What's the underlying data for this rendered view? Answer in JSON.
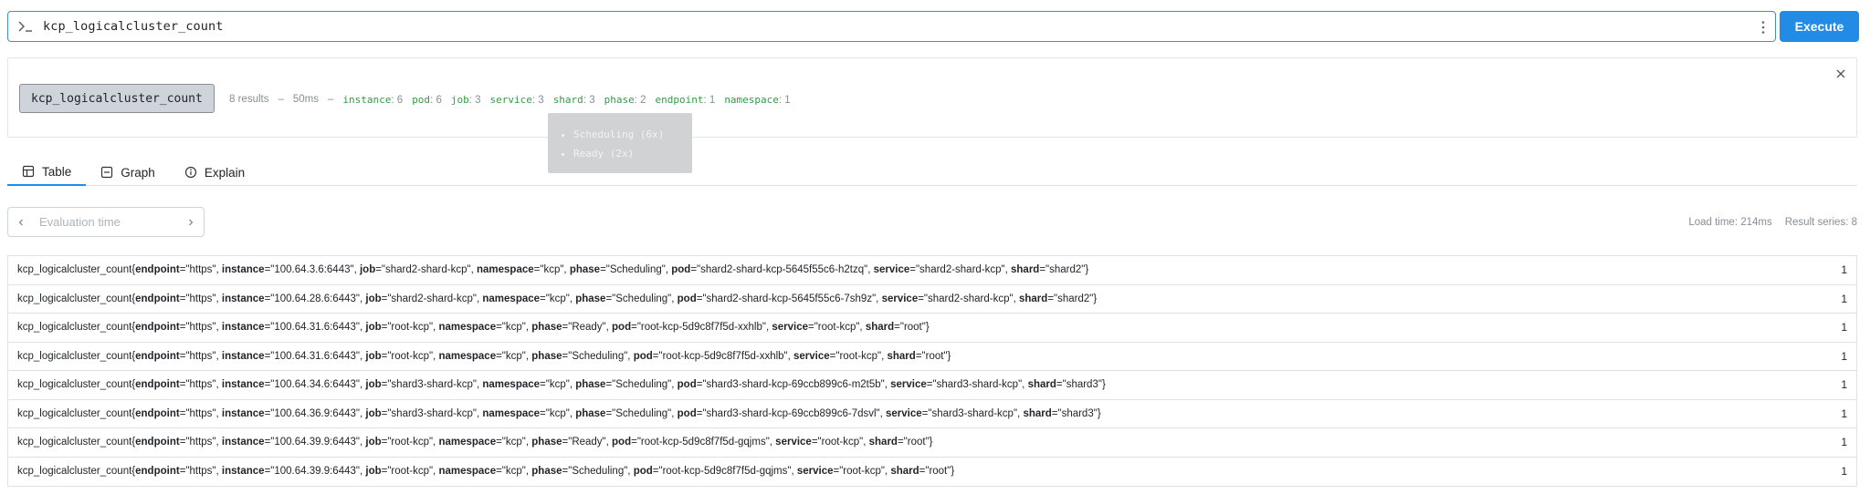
{
  "query": {
    "expression": "kcp_logicalcluster_count",
    "execute_label": "Execute"
  },
  "tree": {
    "metric": "kcp_logicalcluster_count",
    "summary": "8 results",
    "duration": "50ms",
    "labels": [
      {
        "name": "instance",
        "count": "6"
      },
      {
        "name": "pod",
        "count": "6"
      },
      {
        "name": "job",
        "count": "3"
      },
      {
        "name": "service",
        "count": "3"
      },
      {
        "name": "shard",
        "count": "3"
      },
      {
        "name": "phase",
        "count": "2"
      },
      {
        "name": "endpoint",
        "count": "1"
      },
      {
        "name": "namespace",
        "count": "1"
      }
    ],
    "tooltip_items": [
      "Scheduling (6x)",
      "Ready (2x)"
    ]
  },
  "tabs": [
    {
      "label": "Table",
      "icon": "table-icon"
    },
    {
      "label": "Graph",
      "icon": "graph-icon"
    },
    {
      "label": "Explain",
      "icon": "info-icon"
    }
  ],
  "eval_time": {
    "placeholder": "Evaluation time"
  },
  "load_info": {
    "load_time": "Load time: 214ms",
    "result_series": "Result series: 8"
  },
  "results": [
    {
      "metric": "kcp_logicalcluster_count",
      "labels": [
        [
          "endpoint",
          "https"
        ],
        [
          "instance",
          "100.64.3.6:6443"
        ],
        [
          "job",
          "shard2-shard-kcp"
        ],
        [
          "namespace",
          "kcp"
        ],
        [
          "phase",
          "Scheduling"
        ],
        [
          "pod",
          "shard2-shard-kcp-5645f55c6-h2tzq"
        ],
        [
          "service",
          "shard2-shard-kcp"
        ],
        [
          "shard",
          "shard2"
        ]
      ],
      "value": "1"
    },
    {
      "metric": "kcp_logicalcluster_count",
      "labels": [
        [
          "endpoint",
          "https"
        ],
        [
          "instance",
          "100.64.28.6:6443"
        ],
        [
          "job",
          "shard2-shard-kcp"
        ],
        [
          "namespace",
          "kcp"
        ],
        [
          "phase",
          "Scheduling"
        ],
        [
          "pod",
          "shard2-shard-kcp-5645f55c6-7sh9z"
        ],
        [
          "service",
          "shard2-shard-kcp"
        ],
        [
          "shard",
          "shard2"
        ]
      ],
      "value": "1"
    },
    {
      "metric": "kcp_logicalcluster_count",
      "labels": [
        [
          "endpoint",
          "https"
        ],
        [
          "instance",
          "100.64.31.6:6443"
        ],
        [
          "job",
          "root-kcp"
        ],
        [
          "namespace",
          "kcp"
        ],
        [
          "phase",
          "Ready"
        ],
        [
          "pod",
          "root-kcp-5d9c8f7f5d-xxhlb"
        ],
        [
          "service",
          "root-kcp"
        ],
        [
          "shard",
          "root"
        ]
      ],
      "value": "1"
    },
    {
      "metric": "kcp_logicalcluster_count",
      "labels": [
        [
          "endpoint",
          "https"
        ],
        [
          "instance",
          "100.64.31.6:6443"
        ],
        [
          "job",
          "root-kcp"
        ],
        [
          "namespace",
          "kcp"
        ],
        [
          "phase",
          "Scheduling"
        ],
        [
          "pod",
          "root-kcp-5d9c8f7f5d-xxhlb"
        ],
        [
          "service",
          "root-kcp"
        ],
        [
          "shard",
          "root"
        ]
      ],
      "value": "1"
    },
    {
      "metric": "kcp_logicalcluster_count",
      "labels": [
        [
          "endpoint",
          "https"
        ],
        [
          "instance",
          "100.64.34.6:6443"
        ],
        [
          "job",
          "shard3-shard-kcp"
        ],
        [
          "namespace",
          "kcp"
        ],
        [
          "phase",
          "Scheduling"
        ],
        [
          "pod",
          "shard3-shard-kcp-69ccb899c6-m2t5b"
        ],
        [
          "service",
          "shard3-shard-kcp"
        ],
        [
          "shard",
          "shard3"
        ]
      ],
      "value": "1"
    },
    {
      "metric": "kcp_logicalcluster_count",
      "labels": [
        [
          "endpoint",
          "https"
        ],
        [
          "instance",
          "100.64.36.9:6443"
        ],
        [
          "job",
          "shard3-shard-kcp"
        ],
        [
          "namespace",
          "kcp"
        ],
        [
          "phase",
          "Scheduling"
        ],
        [
          "pod",
          "shard3-shard-kcp-69ccb899c6-7dsvl"
        ],
        [
          "service",
          "shard3-shard-kcp"
        ],
        [
          "shard",
          "shard3"
        ]
      ],
      "value": "1"
    },
    {
      "metric": "kcp_logicalcluster_count",
      "labels": [
        [
          "endpoint",
          "https"
        ],
        [
          "instance",
          "100.64.39.9:6443"
        ],
        [
          "job",
          "root-kcp"
        ],
        [
          "namespace",
          "kcp"
        ],
        [
          "phase",
          "Ready"
        ],
        [
          "pod",
          "root-kcp-5d9c8f7f5d-gqjms"
        ],
        [
          "service",
          "root-kcp"
        ],
        [
          "shard",
          "root"
        ]
      ],
      "value": "1"
    },
    {
      "metric": "kcp_logicalcluster_count",
      "labels": [
        [
          "endpoint",
          "https"
        ],
        [
          "instance",
          "100.64.39.9:6443"
        ],
        [
          "job",
          "root-kcp"
        ],
        [
          "namespace",
          "kcp"
        ],
        [
          "phase",
          "Scheduling"
        ],
        [
          "pod",
          "root-kcp-5d9c8f7f5d-gqjms"
        ],
        [
          "service",
          "root-kcp"
        ],
        [
          "shard",
          "root"
        ]
      ],
      "value": "1"
    }
  ],
  "colors": {
    "accent": "#228be6",
    "label_green": "#2f9e44",
    "muted": "#868e96"
  }
}
